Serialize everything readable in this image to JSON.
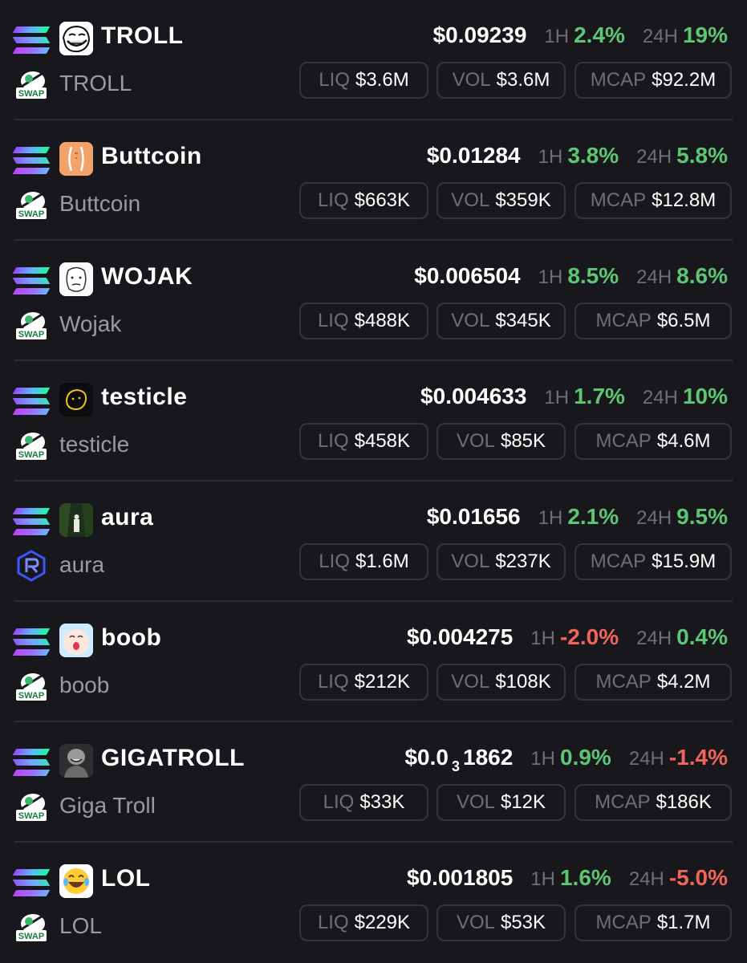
{
  "labels": {
    "h1": "1H",
    "h24": "24H",
    "liq": "LIQ",
    "vol": "VOL",
    "mcap": "MCAP",
    "swap": "SWAP"
  },
  "colors": {
    "positive": "#5cc675",
    "negative": "#f0645a",
    "background": "#18181c"
  },
  "tokens": [
    {
      "symbol": "TROLL",
      "name": "TROLL",
      "avatar_icon": "trollface-icon",
      "dex_icon": "swap-dex-icon",
      "price": "$0.09239",
      "change_1h": "2.4%",
      "change_24h": "19%",
      "liq": "$3.6M",
      "vol": "$3.6M",
      "mcap": "$92.2M"
    },
    {
      "symbol": "Buttcoin",
      "name": "Buttcoin",
      "avatar_icon": "buttcoin-icon",
      "dex_icon": "swap-dex-icon",
      "price": "$0.01284",
      "change_1h": "3.8%",
      "change_24h": "5.8%",
      "liq": "$663K",
      "vol": "$359K",
      "mcap": "$12.8M"
    },
    {
      "symbol": "WOJAK",
      "name": "Wojak",
      "avatar_icon": "wojak-icon",
      "dex_icon": "swap-dex-icon",
      "price": "$0.006504",
      "change_1h": "8.5%",
      "change_24h": "8.6%",
      "liq": "$488K",
      "vol": "$345K",
      "mcap": "$6.5M"
    },
    {
      "symbol": "testicle",
      "name": "testicle",
      "avatar_icon": "testicle-icon",
      "dex_icon": "swap-dex-icon",
      "price": "$0.004633",
      "change_1h": "1.7%",
      "change_24h": "10%",
      "liq": "$458K",
      "vol": "$85K",
      "mcap": "$4.6M"
    },
    {
      "symbol": "aura",
      "name": "aura",
      "avatar_icon": "aura-forest-icon",
      "dex_icon": "raydium-icon",
      "price": "$0.01656",
      "change_1h": "2.1%",
      "change_24h": "9.5%",
      "liq": "$1.6M",
      "vol": "$237K",
      "mcap": "$15.9M"
    },
    {
      "symbol": "boob",
      "name": "boob",
      "avatar_icon": "boob-face-icon",
      "dex_icon": "swap-dex-icon",
      "price": "$0.004275",
      "change_1h": "-2.0%",
      "change_24h": "0.4%",
      "liq": "$212K",
      "vol": "$108K",
      "mcap": "$4.2M"
    },
    {
      "symbol": "GIGATROLL",
      "name": "Giga Troll",
      "avatar_icon": "gigatroll-icon",
      "dex_icon": "swap-dex-icon",
      "price": "$0.0",
      "price_sub": "3",
      "price_tail": "1862",
      "change_1h": "0.9%",
      "change_24h": "-1.4%",
      "liq": "$33K",
      "vol": "$12K",
      "mcap": "$186K"
    },
    {
      "symbol": "LOL",
      "name": "LOL",
      "avatar_icon": "laughing-emoji-icon",
      "dex_icon": "swap-dex-icon",
      "price": "$0.001805",
      "change_1h": "1.6%",
      "change_24h": "-5.0%",
      "liq": "$229K",
      "vol": "$53K",
      "mcap": "$1.7M"
    }
  ]
}
